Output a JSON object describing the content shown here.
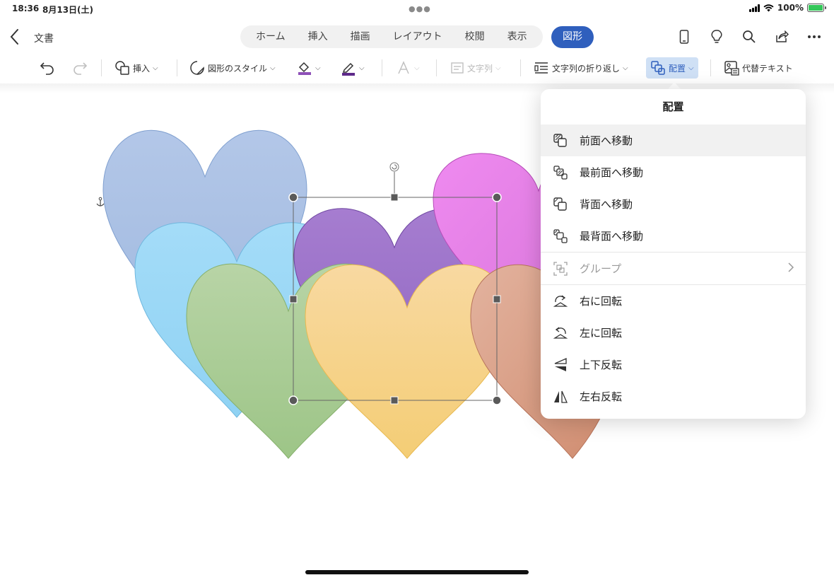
{
  "status": {
    "time": "18:36",
    "date": "8月13日(土)",
    "battery": "100%",
    "battery_level": 1.0
  },
  "nav": {
    "doc_title": "文書",
    "tabs": [
      "ホーム",
      "挿入",
      "描画",
      "レイアウト",
      "校閲",
      "表示"
    ],
    "active_tab": "図形"
  },
  "toolbar": {
    "insert": "挿入",
    "shape_style": "図形のスタイル",
    "text_columns": "文字列",
    "wrap_text": "文字列の折り返し",
    "arrange": "配置",
    "alt_text": "代替テキスト"
  },
  "dropdown": {
    "title": "配置",
    "items": [
      {
        "label": "前面へ移動",
        "icon": "bring-forward-icon"
      },
      {
        "label": "最前面へ移動",
        "icon": "bring-to-front-icon"
      },
      {
        "label": "背面へ移動",
        "icon": "send-backward-icon"
      },
      {
        "label": "最背面へ移動",
        "icon": "send-to-back-icon"
      },
      {
        "label": "グループ",
        "icon": "group-icon",
        "disabled": true
      },
      {
        "label": "右に回転",
        "icon": "rotate-right-icon"
      },
      {
        "label": "左に回転",
        "icon": "rotate-left-icon"
      },
      {
        "label": "上下反転",
        "icon": "flip-vertical-icon"
      },
      {
        "label": "左右反転",
        "icon": "flip-horizontal-icon"
      }
    ]
  },
  "colors": {
    "accent": "#2f5fbd",
    "heart_blue_gray": "#a9c0e3",
    "heart_sky": "#9cd9f6",
    "heart_green": "#aacc96",
    "heart_purple": "#9b74c8",
    "heart_pink": "#e87fe8",
    "heart_yellow": "#f6d28a",
    "heart_salmon": "#d9a088"
  }
}
